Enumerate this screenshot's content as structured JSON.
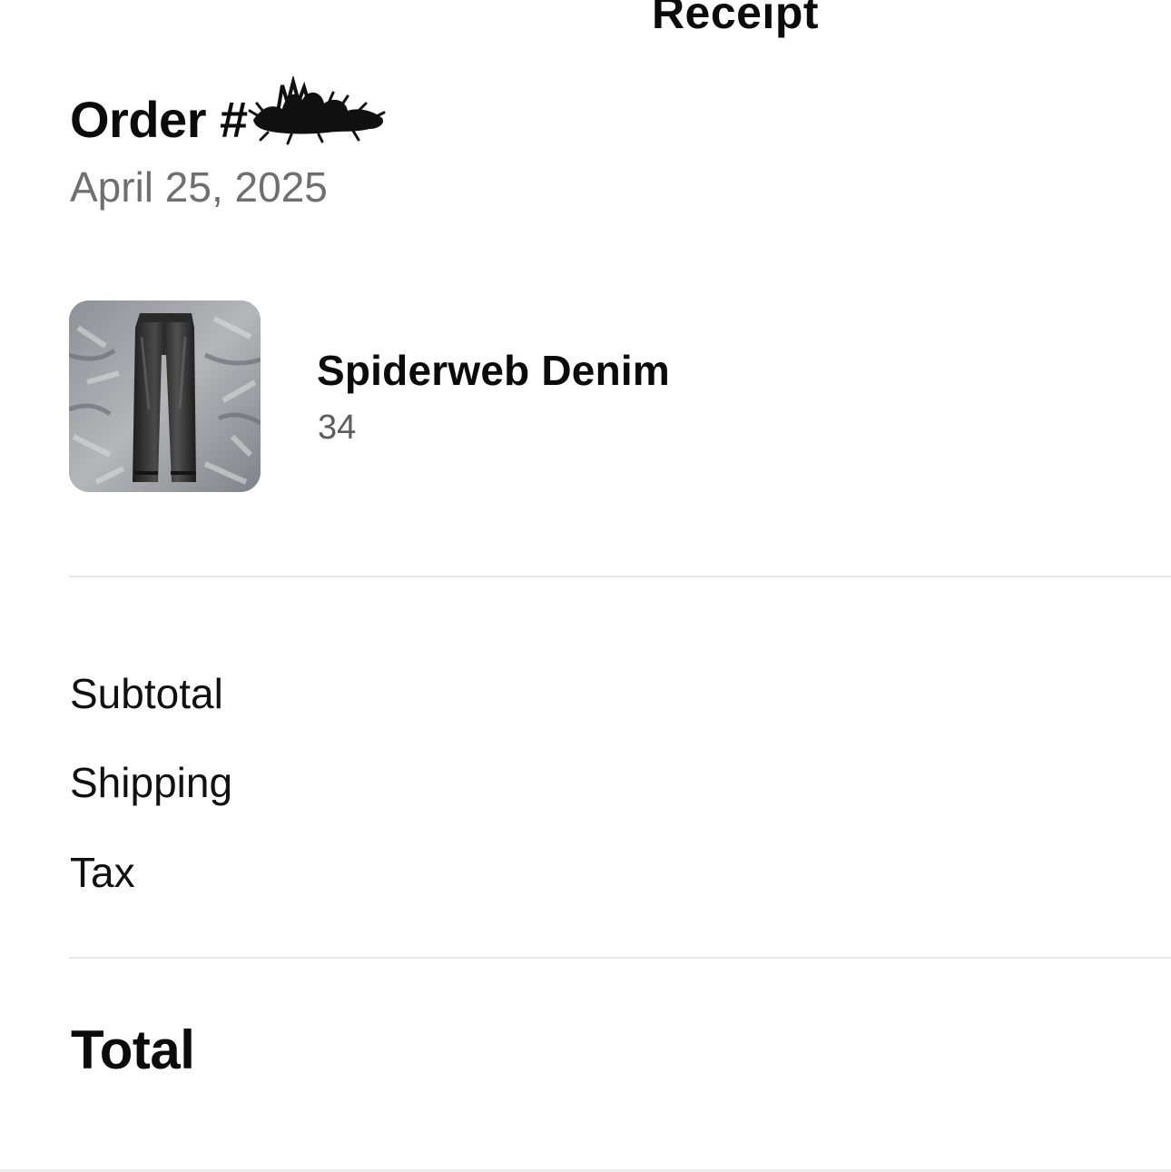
{
  "header": {
    "title": "Receipt"
  },
  "order": {
    "number_label": "Order #",
    "date": "April 25, 2025"
  },
  "items": [
    {
      "name": "Spiderweb Denim",
      "size": "34",
      "image_icon": "jeans-photo"
    }
  ],
  "summary": {
    "subtotal_label": "Subtotal",
    "shipping_label": "Shipping",
    "tax_label": "Tax",
    "total_label": "Total"
  }
}
